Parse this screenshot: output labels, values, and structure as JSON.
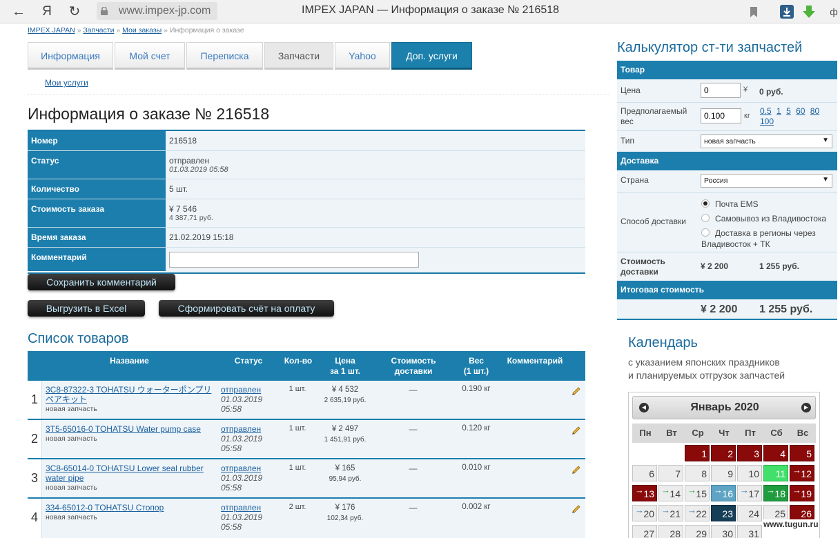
{
  "browser": {
    "back_icon": "arrow-left-icon",
    "yandex_label": "Я",
    "reload_icon": "reload-icon",
    "url": "www.impex-jp.com",
    "window_title": "IMPEX JAPAN — Информация о заказе № 216518"
  },
  "breadcrumb": {
    "items": [
      "IMPEX JAPAN",
      "Запчасти",
      "Мои заказы"
    ],
    "current": "Информация о заказе",
    "separator": "»"
  },
  "tabs": [
    {
      "label": "Информация"
    },
    {
      "label": "Мой счет"
    },
    {
      "label": "Переписка"
    },
    {
      "label": "Запчасти"
    },
    {
      "label": "Yahoo"
    },
    {
      "label": "Доп. услуги"
    }
  ],
  "subnav": {
    "my_services": "Мои услуги"
  },
  "page_title": "Информация о заказе № 216518",
  "order": {
    "number_label": "Номер",
    "number_value": "216518",
    "status_label": "Статус",
    "status_value": "отправлен",
    "status_date": "01.03.2019 05:58",
    "qty_label": "Количество",
    "qty_value": "5 шт.",
    "cost_label": "Стоимость заказа",
    "cost_yen": "¥ 7 546",
    "cost_rub": "4 387,71 руб.",
    "time_label": "Время заказа",
    "time_value": "21.02.2019 15:18",
    "comment_label": "Комментарий",
    "comment_value": ""
  },
  "buttons": {
    "save_comment": "Сохранить комментарий",
    "export_excel": "Выгрузить в Excel",
    "make_invoice": "Сформировать счёт на оплату"
  },
  "goods": {
    "title": "Список товаров",
    "headers": {
      "name": "Название",
      "status": "Статус",
      "qty": "Кол-во",
      "price_1": "Цена",
      "price_2": "за 1 шт.",
      "delivery_1": "Стоимость",
      "delivery_2": "доставки",
      "weight_1": "Вес",
      "weight_2": "(1 шт.)",
      "comment": "Комментарий"
    },
    "rows": [
      {
        "num": "1",
        "name": "3C8-87322-3 TOHATSU ウォーターポンプリペアキット",
        "type": "новая запчасть",
        "status": "отправлен",
        "status_date": "01.03.2019 05:58",
        "qty": "1 шт.",
        "price_yen": "¥ 4 532",
        "price_rub": "2 635,19 руб.",
        "delivery": "—",
        "weight": "0.190 кг"
      },
      {
        "num": "2",
        "name": "3T5-65016-0 TOHATSU Water pump case",
        "type": "новая запчасть",
        "status": "отправлен",
        "status_date": "01.03.2019 05:58",
        "qty": "1 шт.",
        "price_yen": "¥ 2 497",
        "price_rub": "1 451,91 руб.",
        "delivery": "—",
        "weight": "0.120 кг"
      },
      {
        "num": "3",
        "name": "3C8-65014-0 TOHATSU Lower seal rubber water pipe",
        "type": "новая запчасть",
        "status": "отправлен",
        "status_date": "01.03.2019 05:58",
        "qty": "1 шт.",
        "price_yen": "¥ 165",
        "price_rub": "95,94 руб.",
        "delivery": "—",
        "weight": "0.010 кг"
      },
      {
        "num": "4",
        "name": "334-65012-0 TOHATSU Стопор",
        "type": "новая запчасть",
        "status": "отправлен",
        "status_date": "01.03.2019 05:58",
        "qty": "2 шт.",
        "price_yen": "¥ 176",
        "price_rub": "102,34 руб.",
        "delivery": "—",
        "weight": "0.002 кг"
      }
    ]
  },
  "calculator": {
    "title": "Калькулятор ст-ти запчастей",
    "goods_section": "Товар",
    "price_label": "Цена",
    "price_value": "0",
    "price_unit": "¥",
    "price_rub": "0 руб.",
    "weight_label": "Предполагаемый вес",
    "weight_value": "0.100",
    "weight_unit": "кг",
    "weight_presets": [
      "0.5",
      "1",
      "5",
      "60",
      "80",
      "100"
    ],
    "type_label": "Тип",
    "type_value": "новая запчасть",
    "delivery_section": "Доставка",
    "country_label": "Страна",
    "country_value": "Россия",
    "method_label": "Способ доставки",
    "methods": [
      {
        "label": "Почта EMS",
        "selected": true
      },
      {
        "label": "Самовывоз из Владивостока",
        "selected": false
      },
      {
        "label": "Доставка в регионы через Владивосток + ТК",
        "selected": false
      }
    ],
    "delivery_cost_label": "Стоимость доставки",
    "delivery_cost_yen": "¥ 2 200",
    "delivery_cost_rub": "1 255 руб.",
    "total_section": "Итоговая стоимость",
    "total_yen": "¥ 2 200",
    "total_rub": "1 255 руб."
  },
  "calendar": {
    "title": "Календарь",
    "subtitle_1": "с указанием японских праздников",
    "subtitle_2": "и планируемых отгрузок запчастей",
    "month": "Январь 2020",
    "weekdays": [
      "Пн",
      "Вт",
      "Ср",
      "Чт",
      "Пт",
      "Сб",
      "Вс"
    ],
    "colors": {
      "holiday": "#8a0a0a",
      "shipment": "#1f9c3e",
      "today": "#153e57",
      "accent": "#1b7ead"
    }
  },
  "watermark": "www.tugun.ru"
}
